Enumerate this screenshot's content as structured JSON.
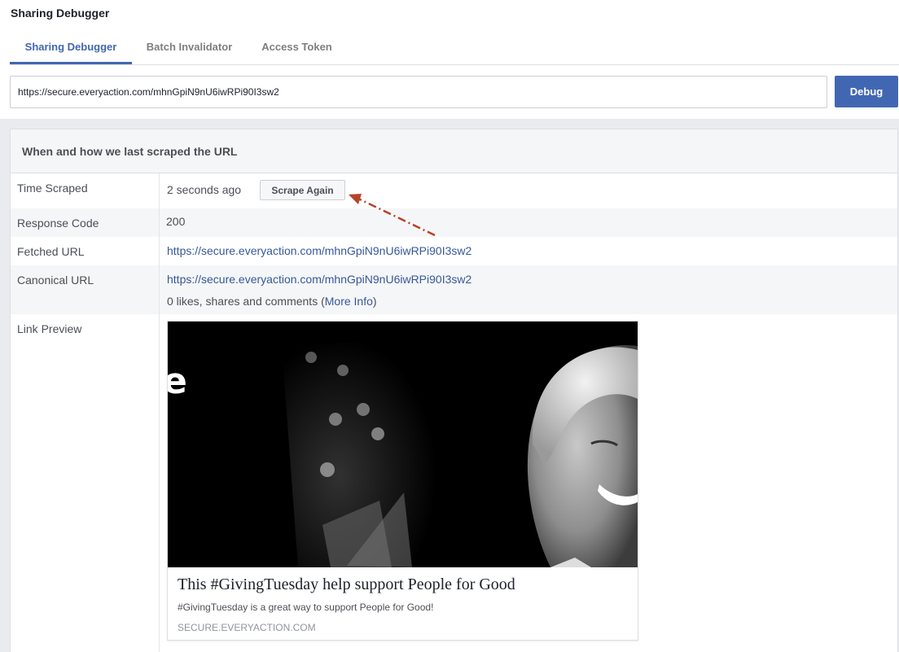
{
  "page": {
    "title": "Sharing Debugger"
  },
  "tabs": [
    {
      "label": "Sharing Debugger",
      "active": true
    },
    {
      "label": "Batch Invalidator",
      "active": false
    },
    {
      "label": "Access Token",
      "active": false
    }
  ],
  "search": {
    "value": "https://secure.everyaction.com/mhnGpiN9nU6iwRPi90I3sw2",
    "button_label": "Debug"
  },
  "panel": {
    "title": "When and how we last scraped the URL",
    "time_scraped": {
      "label": "Time Scraped",
      "value": "2 seconds ago",
      "button_label": "Scrape Again"
    },
    "response_code": {
      "label": "Response Code",
      "value": "200"
    },
    "fetched_url": {
      "label": "Fetched URL",
      "value": "https://secure.everyaction.com/mhnGpiN9nU6iwRPi90I3sw2"
    },
    "canonical_url": {
      "label": "Canonical URL",
      "value": "https://secure.everyaction.com/mhnGpiN9nU6iwRPi90I3sw2",
      "engagement_text": "0 likes, shares and comments (",
      "more_info_label": "More Info",
      "engagement_suffix": ")"
    },
    "link_preview": {
      "label": "Link Preview",
      "image_letter": "e",
      "title": "This #GivingTuesday help support People for Good",
      "description": "#GivingTuesday is a great way to support People for Good!",
      "domain": "SECURE.EVERYACTION.COM"
    }
  },
  "colors": {
    "accent": "#4267b2",
    "link": "#365899",
    "annotation_arrow": "#b5432a"
  }
}
